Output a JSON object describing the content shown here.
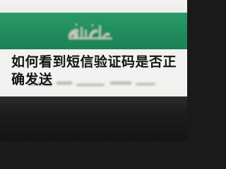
{
  "article": {
    "title": "如何看到短信验证码是否正确发送"
  },
  "colors": {
    "flag_green": "#1f8a5c",
    "flag_white": "#f2f2f0",
    "flag_black": "#1c1c1c",
    "emblem": "#c9c6b8",
    "title_text": "#141414"
  },
  "icons": {
    "emblem": "flag-emblem-icon"
  }
}
